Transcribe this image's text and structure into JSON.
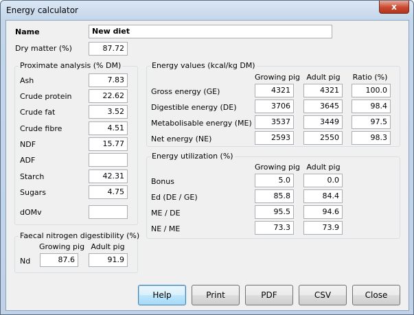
{
  "window": {
    "title": "Energy calculator",
    "close_glyph": "x"
  },
  "name": {
    "label": "Name",
    "value": "New diet"
  },
  "dry_matter": {
    "label": "Dry matter (%)",
    "value": "87.72"
  },
  "proximate": {
    "title": "Proximate analysis (% DM)",
    "items": [
      {
        "label": "Ash",
        "value": "7.83"
      },
      {
        "label": "Crude protein",
        "value": "22.62"
      },
      {
        "label": "Crude fat",
        "value": "3.52"
      },
      {
        "label": "Crude fibre",
        "value": "4.51"
      },
      {
        "label": "NDF",
        "value": "15.77"
      },
      {
        "label": "ADF",
        "value": ""
      },
      {
        "label": "Starch",
        "value": "42.31"
      },
      {
        "label": "Sugars",
        "value": "4.75"
      },
      {
        "label": "dOMv",
        "value": ""
      }
    ]
  },
  "faecal": {
    "title": "Faecal nitrogen digestibility (%)",
    "col_growing": "Growing pig",
    "col_adult": "Adult pig",
    "row_label": "Nd",
    "growing": "87.6",
    "adult": "91.9"
  },
  "energy": {
    "title": "Energy values (kcal/kg DM)",
    "col_growing": "Growing pig",
    "col_adult": "Adult pig",
    "col_ratio": "Ratio (%)",
    "rows": [
      {
        "label": "Gross energy (GE)",
        "growing": "4321",
        "adult": "4321",
        "ratio": "100.0"
      },
      {
        "label": "Digestible energy (DE)",
        "growing": "3706",
        "adult": "3645",
        "ratio": "98.4"
      },
      {
        "label": "Metabolisable energy (ME)",
        "growing": "3537",
        "adult": "3449",
        "ratio": "97.5"
      },
      {
        "label": "Net energy (NE)",
        "growing": "2593",
        "adult": "2550",
        "ratio": "98.3"
      }
    ]
  },
  "utilization": {
    "title": "Energy utilization (%)",
    "col_growing": "Growing pig",
    "col_adult": "Adult pig",
    "rows": [
      {
        "label": "Bonus",
        "growing": "5.0",
        "adult": "0.0"
      },
      {
        "label": "Ed (DE / GE)",
        "growing": "85.8",
        "adult": "84.4"
      },
      {
        "label": "ME / DE",
        "growing": "95.5",
        "adult": "94.6"
      },
      {
        "label": "NE / ME",
        "growing": "73.3",
        "adult": "73.9"
      }
    ]
  },
  "buttons": {
    "help": "Help",
    "print": "Print",
    "pdf": "PDF",
    "csv": "CSV",
    "close": "Close"
  }
}
